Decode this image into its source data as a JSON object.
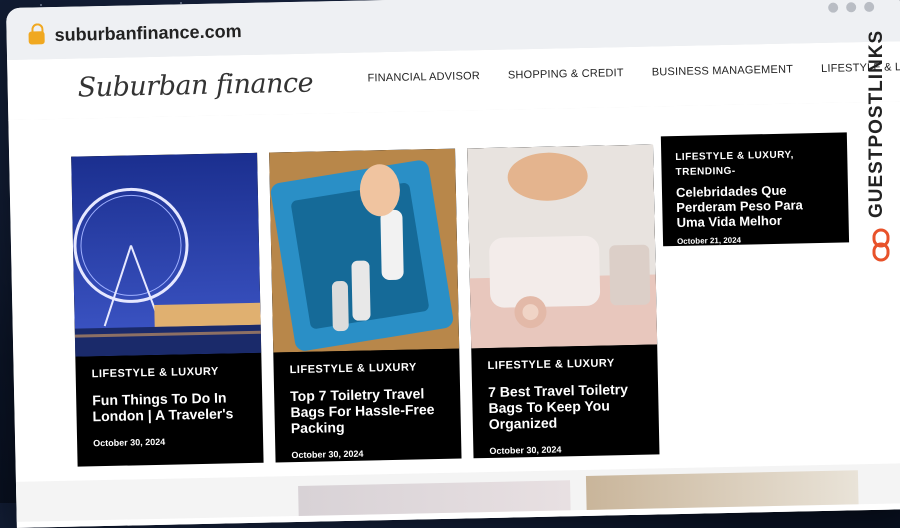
{
  "browser": {
    "url": "suburbanfinance.com"
  },
  "site": {
    "logo": "Suburban finance",
    "nav": [
      "FINANCIAL ADVISOR",
      "SHOPPING & CREDIT",
      "BUSINESS MANAGEMENT",
      "LIFESTYLE & LUXURY"
    ]
  },
  "cards": [
    {
      "category": "LIFESTYLE & LUXURY",
      "title": "Fun Things To Do In London | A Traveler's",
      "date": "October 30, 2024"
    },
    {
      "category": "LIFESTYLE & LUXURY",
      "title": "Top 7 Toiletry Travel Bags For Hassle-Free Packing",
      "date": "October 30, 2024"
    },
    {
      "category": "LIFESTYLE & LUXURY",
      "title": "7 Best Travel Toiletry Bags To Keep You Organized",
      "date": "October 30, 2024"
    }
  ],
  "side_card": {
    "category_line1": "LIFESTYLE & LUXURY,",
    "category_line2": "TRENDING-",
    "title": "Celebridades Que Perderam Peso Para Uma Vida Melhor",
    "date": "October 21, 2024"
  },
  "badge": {
    "text": "GUESTPOSTLINKS"
  },
  "colors": {
    "lock": "#f0a820",
    "card_bg": "#000000",
    "badge_accent": "#e8522a"
  }
}
